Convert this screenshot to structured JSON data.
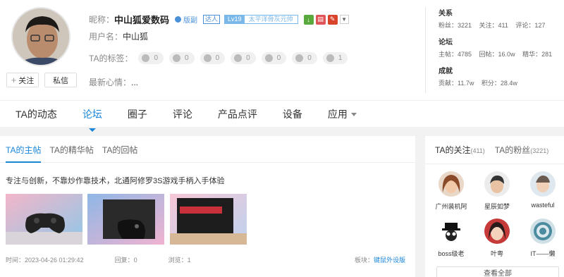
{
  "profile": {
    "nickname_label": "昵称：",
    "nickname": "中山狐爱数码",
    "mod_tag": "版副",
    "daren_tag": "达人",
    "level": "Lv19",
    "level_title": "太平洋骨灰元帅",
    "username_label": "用户名：",
    "username": "中山狐",
    "tags_label": "TA的标签：",
    "tags": [
      "0",
      "0",
      "0",
      "0",
      "0",
      "0",
      "1"
    ],
    "mood_label": "最新心情：",
    "mood": "...",
    "follow_btn": "关注",
    "message_btn": "私信"
  },
  "stats": {
    "relations_title": "关系",
    "fans": "粉丝：3221",
    "following": "关注：411",
    "comments": "评论：127",
    "forum_title": "论坛",
    "posts": "主帖：4785",
    "replies": "回帖：16.0w",
    "featured": "精华：281",
    "score_title": "成就",
    "contribution": "贡献：11.7w",
    "points": "积分：28.4w"
  },
  "nav": {
    "items": [
      "TA的动态",
      "论坛",
      "圈子",
      "评论",
      "产品点评",
      "设备",
      "应用"
    ]
  },
  "main": {
    "subtabs": [
      "TA的主帖",
      "TA的精华帖",
      "TA的回帖"
    ],
    "post": {
      "title": "专注与创新，不靠炒作靠技术，北通阿修罗3S游戏手柄入手体验",
      "time": "时间：2023-04-26 01:29:42",
      "reply": "回复：0",
      "views": "浏览：1",
      "board_label": "板块：",
      "board": "键鼠外设版"
    }
  },
  "side": {
    "tab_following": "TA的关注",
    "tab_following_count": "(411)",
    "tab_fans": "TA的粉丝",
    "tab_fans_count": "(3221)",
    "follows": [
      "广州装机阿",
      "星辰如梦",
      "wasteful",
      "boss级老",
      "叶粤",
      "IT——懒"
    ],
    "view_all": "查看全部"
  },
  "colors": {
    "accent": "#1a86d9",
    "level": "#7ab8ea"
  }
}
